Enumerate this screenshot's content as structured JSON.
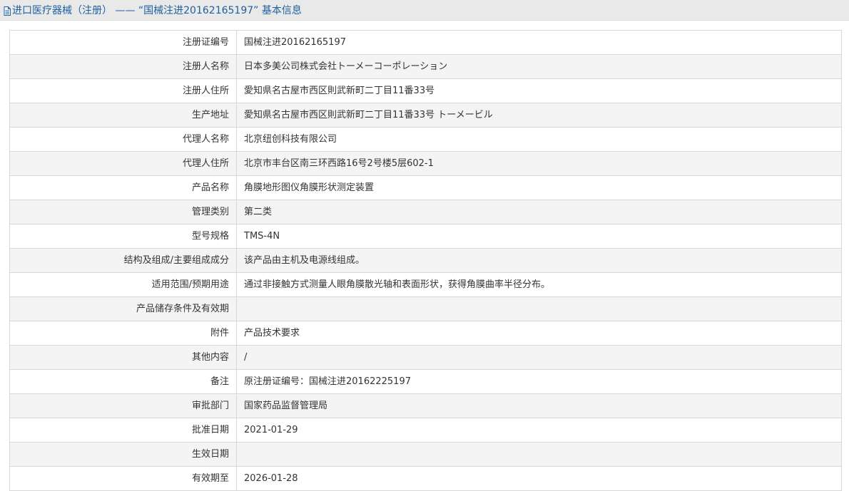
{
  "header": {
    "icon": "document-icon",
    "title": "进口医疗器械（注册） —— “国械注进20162165197” 基本信息",
    "title_color": "#1f5fa0"
  },
  "rows": [
    {
      "label": "注册证编号",
      "value": "国械注进20162165197"
    },
    {
      "label": "注册人名称",
      "value": "日本多美公司株式会社トーメーコーポレーション"
    },
    {
      "label": "注册人住所",
      "value": "愛知県名古屋市西区則武新町二丁目11番33号"
    },
    {
      "label": "生产地址",
      "value": "愛知県名古屋市西区則武新町二丁目11番33号 トーメービル"
    },
    {
      "label": "代理人名称",
      "value": "北京纽创科技有限公司"
    },
    {
      "label": "代理人住所",
      "value": "北京市丰台区南三环西路16号2号楼5层602-1"
    },
    {
      "label": "产品名称",
      "value": "角膜地形图仪角膜形状测定装置"
    },
    {
      "label": "管理类别",
      "value": "第二类"
    },
    {
      "label": "型号规格",
      "value": "TMS-4N"
    },
    {
      "label": "结构及组成/主要组成成分",
      "value": "该产品由主机及电源线组成。"
    },
    {
      "label": "适用范围/预期用途",
      "value": "通过非接触方式测量人眼角膜散光轴和表面形状，获得角膜曲率半径分布。"
    },
    {
      "label": "产品储存条件及有效期",
      "value": ""
    },
    {
      "label": "附件",
      "value": "产品技术要求"
    },
    {
      "label": "其他内容",
      "value": "/"
    },
    {
      "label": "备注",
      "value": "原注册证编号：国械注进20162225197"
    },
    {
      "label": "审批部门",
      "value": "国家药品监督管理局"
    },
    {
      "label": "批准日期",
      "value": "2021-01-29"
    },
    {
      "label": "生效日期",
      "value": ""
    },
    {
      "label": "有效期至",
      "value": "2026-01-28"
    }
  ]
}
